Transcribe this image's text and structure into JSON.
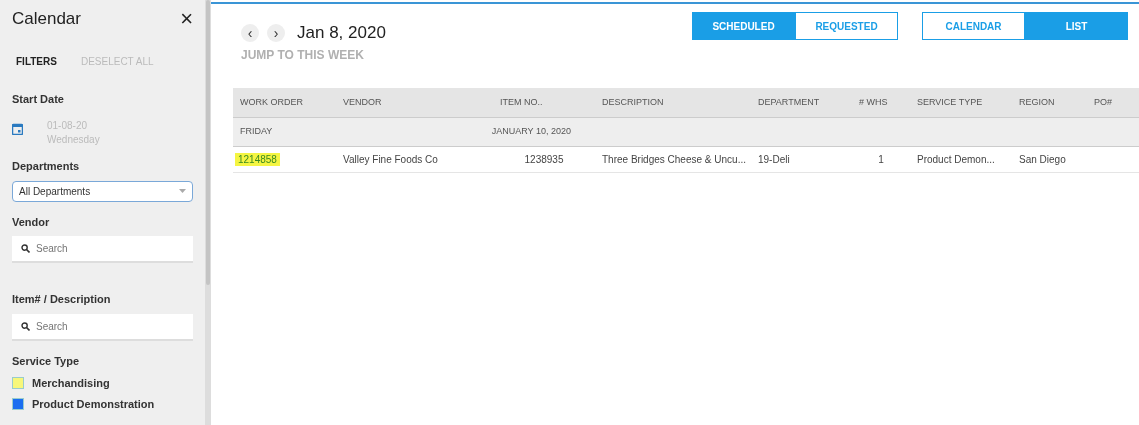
{
  "sidebar": {
    "title": "Calendar",
    "close": "×",
    "filters_label": "FILTERS",
    "deselect_all": "DESELECT ALL",
    "start_date": {
      "label": "Start Date",
      "date": "01-08-20",
      "weekday": "Wednesday"
    },
    "departments": {
      "label": "Departments",
      "value": "All Departments"
    },
    "vendor": {
      "label": "Vendor",
      "placeholder": "Search"
    },
    "item": {
      "label": "Item# / Description",
      "placeholder": "Search"
    },
    "service_type": {
      "label": "Service Type",
      "items": [
        {
          "label": "Merchandising",
          "color": "#f7f77a"
        },
        {
          "label": "Product Demonstration",
          "color": "#1a6ef0"
        }
      ]
    }
  },
  "header": {
    "prev": "‹",
    "next": "›",
    "date": "Jan 8, 2020",
    "jump": "JUMP TO THIS WEEK",
    "status_tabs": [
      {
        "label": "SCHEDULED",
        "selected": true
      },
      {
        "label": "REQUESTED",
        "selected": false
      }
    ],
    "view_tabs": [
      {
        "label": "CALENDAR",
        "selected": false
      },
      {
        "label": "LIST",
        "selected": true
      }
    ]
  },
  "table": {
    "columns": [
      "WORK ORDER",
      "VENDOR",
      "ITEM NO..",
      "DESCRIPTION",
      "DEPARTMENT",
      "# WHS",
      "SERVICE TYPE",
      "REGION",
      "PO#"
    ],
    "groups": [
      {
        "day": "FRIDAY",
        "date": "JANUARY 10, 2020",
        "rows": [
          {
            "cells": [
              "1214858",
              "Valley Fine Foods Co",
              "1238935",
              "Three Bridges Cheese & Uncu...",
              "19-Deli",
              "1",
              "Product Demon...",
              "San Diego"
            ],
            "highlighted": true
          }
        ]
      }
    ]
  }
}
